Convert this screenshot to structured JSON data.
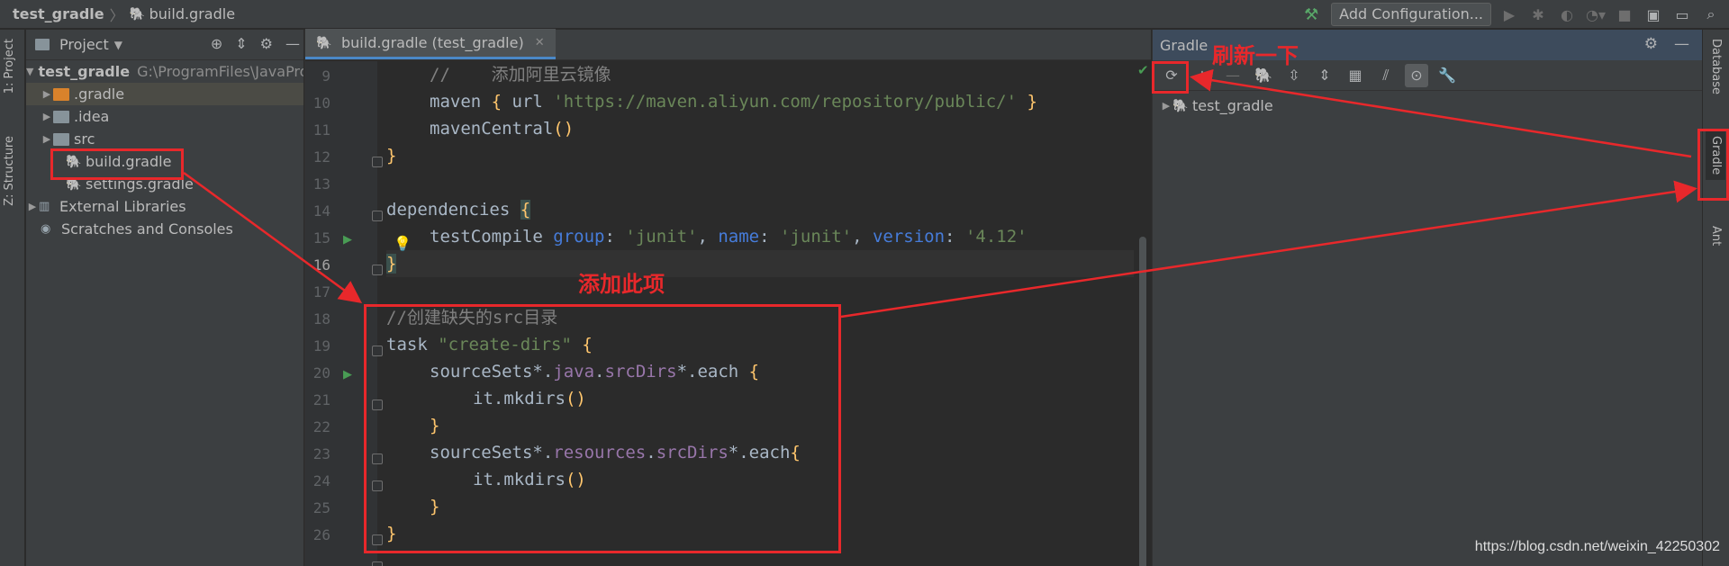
{
  "breadcrumb": {
    "project": "test_gradle",
    "file": "build.gradle"
  },
  "toolbar": {
    "add_configuration": "Add Configuration..."
  },
  "left_strip": {
    "tab_project": "1: Project",
    "tab_structure": "Z: Structure"
  },
  "project_panel": {
    "title": "Project",
    "root": {
      "name": "test_gradle",
      "path": "G:\\ProgramFiles\\JavaPro"
    },
    "items": [
      {
        "label": ".gradle"
      },
      {
        "label": ".idea"
      },
      {
        "label": "src"
      },
      {
        "label": "build.gradle"
      },
      {
        "label": "settings.gradle"
      },
      {
        "label": "External Libraries"
      },
      {
        "label": "Scratches and Consoles"
      }
    ]
  },
  "editor": {
    "tab_label": "build.gradle (test_gradle)",
    "line_numbers": [
      "9",
      "10",
      "11",
      "12",
      "13",
      "14",
      "15",
      "16",
      "17",
      "18",
      "19",
      "20",
      "21",
      "22",
      "23",
      "24",
      "25",
      "26"
    ],
    "code": {
      "l9": "//    添加阿里云镜像",
      "l10_a": "maven ",
      "l10_b": "{",
      "l10_c": " url ",
      "l10_d": "'https://maven.aliyun.com/repository/public/'",
      "l10_e": " }",
      "l11_a": "mavenCentral",
      "l11_b": "()",
      "l12": "}",
      "l14_a": "dependencies ",
      "l14_b": "{",
      "l15_a": "testCompile ",
      "l15_b": "group",
      "l15_c": ": ",
      "l15_d": "'junit'",
      "l15_e": ", ",
      "l15_f": "name",
      "l15_g": ": ",
      "l15_h": "'junit'",
      "l15_i": ", ",
      "l15_j": "version",
      "l15_k": ": ",
      "l15_l": "'4.12'",
      "l16": "}",
      "l18": "//创建缺失的src目录",
      "l19_a": "task ",
      "l19_b": "\"create-dirs\"",
      "l19_c": " {",
      "l20_a": "sourceSets*.",
      "l20_b": "java",
      "l20_c": ".",
      "l20_d": "srcDirs",
      "l20_e": "*.each ",
      "l20_f": "{",
      "l21_a": "it.mkdirs",
      "l21_b": "()",
      "l22": "}",
      "l23_a": "sourceSets*.",
      "l23_b": "resources",
      "l23_c": ".",
      "l23_d": "srcDirs",
      "l23_e": "*.each",
      "l23_f": "{",
      "l24_a": "it.mkdirs",
      "l24_b": "()",
      "l25": "}",
      "l26": "}"
    }
  },
  "gradle_panel": {
    "title": "Gradle",
    "tree_root": "test_gradle"
  },
  "right_strip": {
    "tab_database": "Database",
    "tab_gradle": "Gradle",
    "tab_ant": "Ant"
  },
  "annotations": {
    "refresh_label": "刷新一下",
    "add_label": "添加此项",
    "color": "#e8282b"
  },
  "watermark": "https://blog.csdn.net/weixin_42250302"
}
